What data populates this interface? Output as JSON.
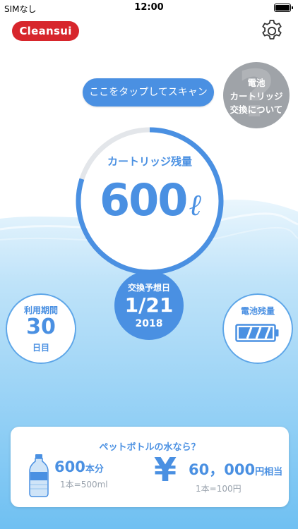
{
  "status_bar": {
    "carrier": "SIMなし",
    "time": "12:00"
  },
  "header": {
    "logo_text": "Cleansui"
  },
  "scan_button": {
    "label": "ここをタップしてスキャン"
  },
  "info_button": {
    "line1": "電池",
    "line2": "カートリッジ",
    "line3": "交換について"
  },
  "gauge": {
    "label": "カートリッジ残量",
    "value": "600",
    "unit": "ℓ",
    "remaining_fraction": 0.8
  },
  "prediction": {
    "label": "交換予想日",
    "date": "1/21",
    "year": "2018"
  },
  "usage": {
    "label": "利用期間",
    "value": "30",
    "unit": "日目"
  },
  "battery": {
    "label": "電池残量",
    "level_fraction": 1.0
  },
  "bottle_card": {
    "title": "ペットボトルの水なら？",
    "bottle_count": "600",
    "bottle_suffix": "本分",
    "bottle_note": "1本=500ml",
    "yen_sign": "¥",
    "price": "60，000",
    "price_suffix": "円相当",
    "price_note": "1本=100円"
  },
  "colors": {
    "accent": "#4a90e2",
    "logo_red": "#d7262c",
    "info_gray": "#9fa3a8",
    "water_light": "#d6edfb",
    "water_deep": "#77c4f3"
  }
}
